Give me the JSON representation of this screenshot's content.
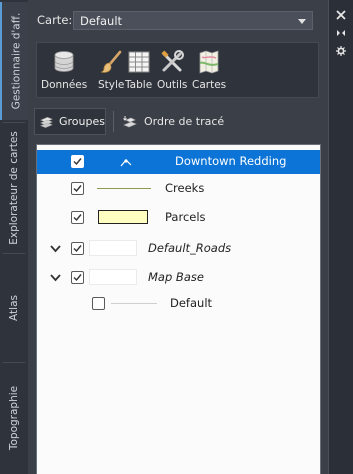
{
  "vertical_tabs": [
    {
      "label": "Gestionnaire d'aff."
    },
    {
      "label": "Explorateur de cartes"
    },
    {
      "label": "Atlas"
    },
    {
      "label": "Topographie"
    }
  ],
  "map_selector": {
    "label": "Carte:",
    "value": "Default"
  },
  "toolbar": [
    {
      "label": "Données",
      "icon": "database-icon"
    },
    {
      "label": "Style",
      "icon": "brush-icon"
    },
    {
      "label": "Table",
      "icon": "table-icon"
    },
    {
      "label": "Outils",
      "icon": "tools-icon"
    },
    {
      "label": "Cartes",
      "icon": "maps-icon"
    }
  ],
  "view_tabs": {
    "groups": "Groupes",
    "draw_order": "Ordre de tracé"
  },
  "layers": [
    {
      "label": "Downtown Redding",
      "checked": true,
      "selected": true,
      "style": "icon",
      "italic": false
    },
    {
      "label": "Creeks",
      "checked": true,
      "selected": false,
      "style": "line",
      "italic": false
    },
    {
      "label": "Parcels",
      "checked": true,
      "selected": false,
      "style": "box",
      "italic": false
    },
    {
      "label": "Default_Roads",
      "checked": true,
      "selected": false,
      "style": "blank",
      "italic": true,
      "collapsible": true
    },
    {
      "label": "Map Base",
      "checked": true,
      "selected": false,
      "style": "blank",
      "italic": true,
      "collapsible": true
    },
    {
      "label": "Default",
      "checked": false,
      "selected": false,
      "style": "thinline",
      "italic": false
    }
  ],
  "colors": {
    "selection": "#0b74d6",
    "panel": "#3b3f48",
    "parcels_fill": "#ffffc2",
    "creeks_line": "#8f9a4e"
  }
}
